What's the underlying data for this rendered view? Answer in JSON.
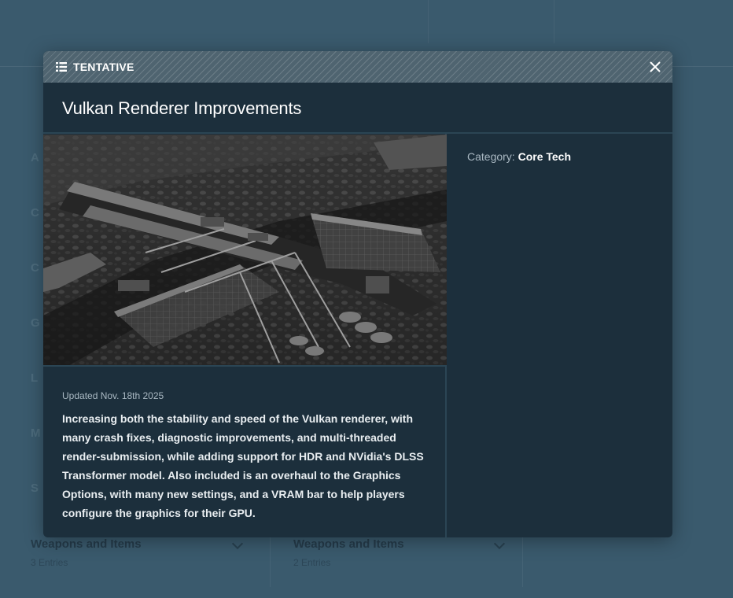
{
  "modal": {
    "status_label": "TENTATIVE",
    "title": "Vulkan Renderer Improvements",
    "updated": "Updated Nov. 18th 2025",
    "description": "Increasing both the stability and speed of the Vulkan renderer, with many crash fixes, diagnostic improvements, and multi-threaded render-submission, while adding support for HDR and NVidia's DLSS Transformer model. Also included is an overhaul to the Graphics Options, with many new settings, and a VRAM bar to help players configure the graphics for their GPU.",
    "category_key": "Category:",
    "category_value": "Core Tech",
    "icons": {
      "status": "list-icon",
      "close": "close-icon"
    },
    "image": "industrial-structure-render"
  },
  "background": {
    "cards": [
      {
        "title": "Weapons and Items",
        "sub": "3 Entries"
      },
      {
        "title": "Weapons and Items",
        "sub": "2 Entries"
      }
    ]
  },
  "colors": {
    "page_bg": "#3a5a6d",
    "modal_bg": "#1c2f3c",
    "header_bg": "#4f6470",
    "divider": "#2b4554",
    "muted_text": "#a9b8c2"
  }
}
